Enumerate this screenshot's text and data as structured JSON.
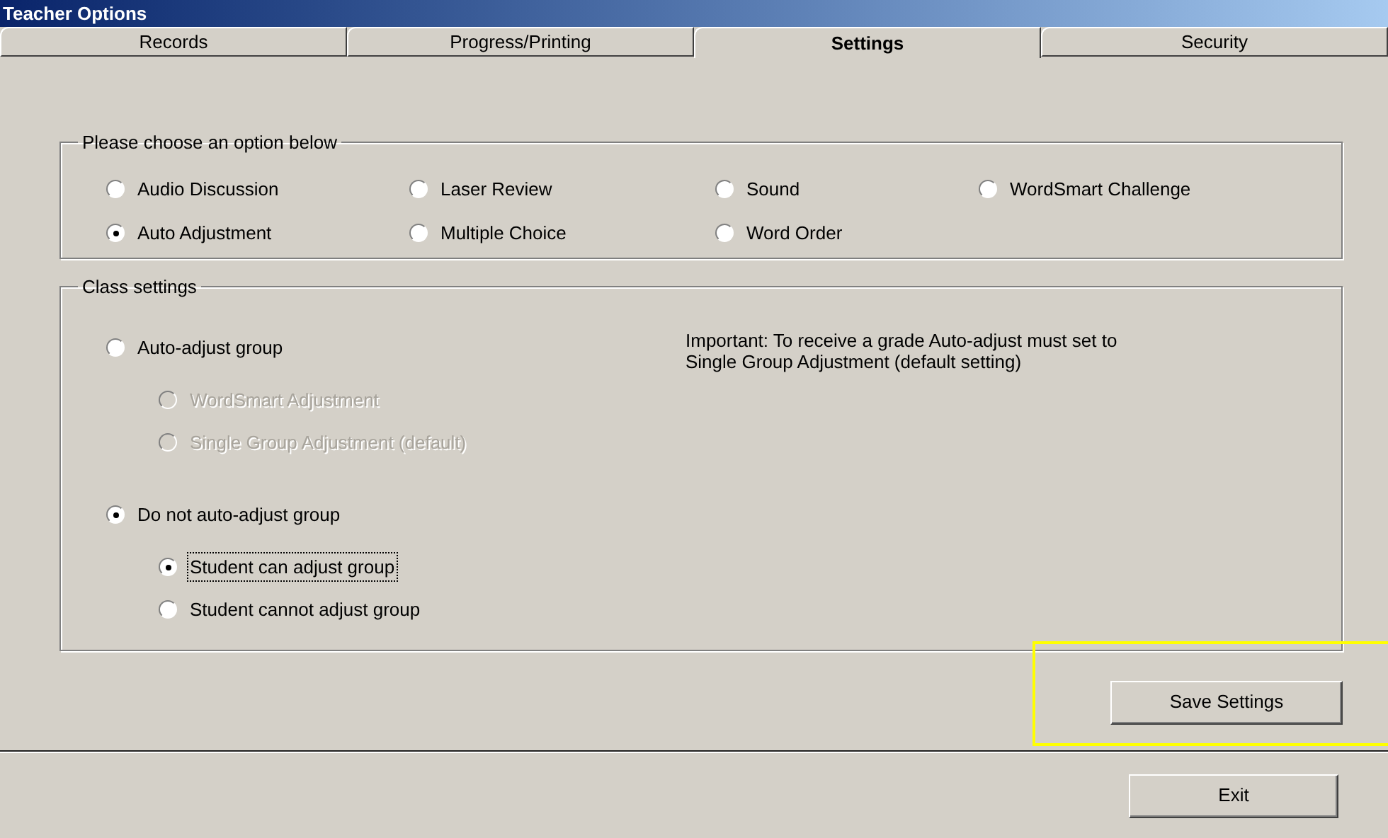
{
  "window": {
    "title": "Teacher Options"
  },
  "tabs": [
    {
      "label": "Records",
      "selected": false
    },
    {
      "label": "Progress/Printing",
      "selected": false
    },
    {
      "label": "Settings",
      "selected": true
    },
    {
      "label": "Security",
      "selected": false
    }
  ],
  "option_group": {
    "title": "Please choose an option below",
    "options": [
      {
        "label": "Audio Discussion",
        "selected": false
      },
      {
        "label": "Laser Review",
        "selected": false
      },
      {
        "label": "Sound",
        "selected": false
      },
      {
        "label": "WordSmart Challenge",
        "selected": false
      },
      {
        "label": "Auto Adjustment",
        "selected": true
      },
      {
        "label": "Multiple Choice",
        "selected": false
      },
      {
        "label": "Word Order",
        "selected": false
      }
    ]
  },
  "class_settings": {
    "title": "Class settings",
    "note": "Important: To receive a grade Auto-adjust must set to Single Group Adjustment (default setting)",
    "choices": [
      {
        "label": "Auto-adjust group",
        "selected": false,
        "children": [
          {
            "label": "WordSmart Adjustment",
            "selected": false,
            "disabled": true,
            "focused": false
          },
          {
            "label": "Single Group Adjustment (default)",
            "selected": false,
            "disabled": true,
            "focused": false
          }
        ]
      },
      {
        "label": "Do not auto-adjust group",
        "selected": true,
        "children": [
          {
            "label": "Student can adjust group",
            "selected": true,
            "disabled": false,
            "focused": true
          },
          {
            "label": "Student cannot adjust group",
            "selected": false,
            "disabled": false,
            "focused": false
          }
        ]
      }
    ]
  },
  "save_button": {
    "label": "Save Settings",
    "highlighted": true
  },
  "exit_button": {
    "label": "Exit"
  }
}
